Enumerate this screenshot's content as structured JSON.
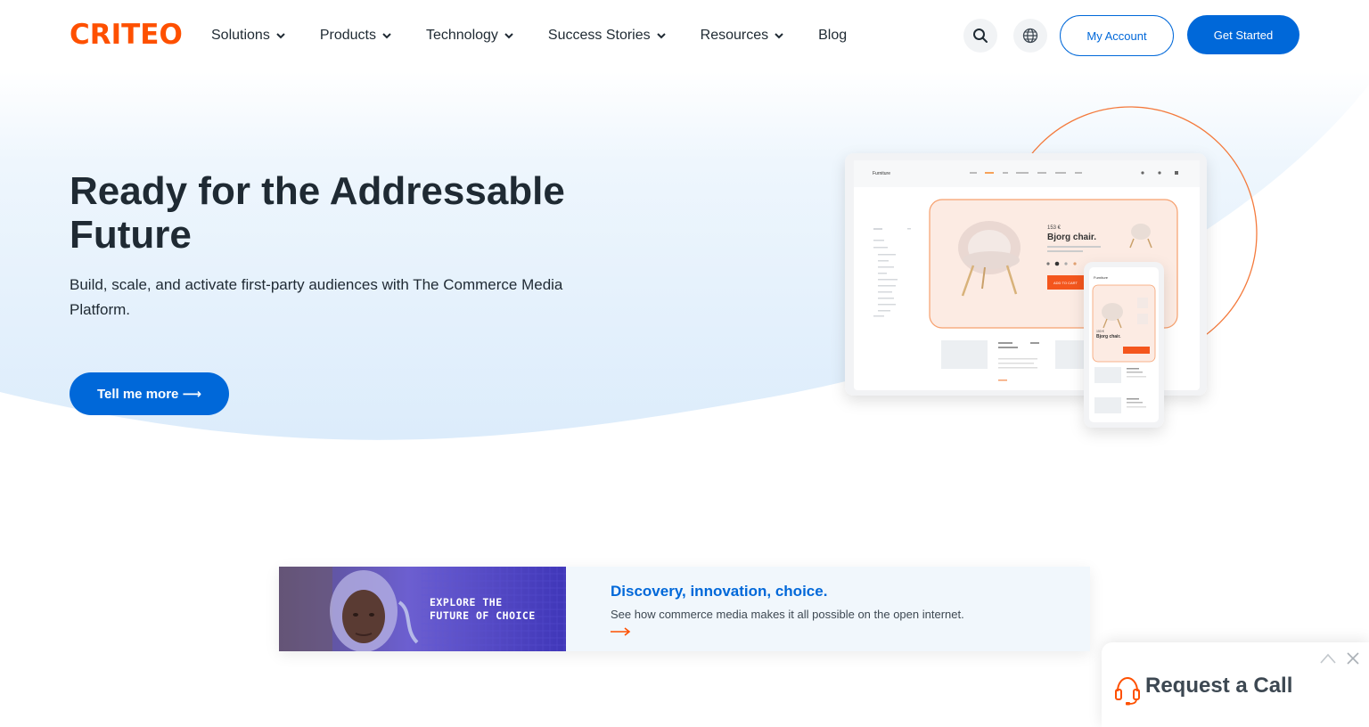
{
  "brand": {
    "logo_text": "CRITEO",
    "accent": "#fe5000",
    "primary": "#0068d9"
  },
  "nav": {
    "items": [
      {
        "label": "Solutions"
      },
      {
        "label": "Products"
      },
      {
        "label": "Technology"
      },
      {
        "label": "Success Stories"
      },
      {
        "label": "Resources"
      }
    ],
    "blog_label": "Blog",
    "search_icon": "search-icon",
    "language_icon": "globe-icon",
    "account_label": "My Account",
    "started_label": "Get Started"
  },
  "hero": {
    "title": "Ready for the Addressable Future",
    "subtitle": "Build, scale, and activate first-party audiences with The Commerce Media Platform.",
    "cta_label": "Tell me more ⟶"
  },
  "mockup": {
    "tablet_title": "Furniture",
    "price": "153 €",
    "product_name": "Bjorg chair.",
    "add_to_cart": "ADD TO CART",
    "phone_title": "Furniture",
    "phone_price": "153 €",
    "phone_product": "Bjorg chair."
  },
  "promo": {
    "overlay_line1": "EXPLORE THE",
    "overlay_line2": "FUTURE OF CHOICE",
    "title": "Discovery, innovation, choice.",
    "description": "See how commerce media makes it all possible on the open internet."
  },
  "call_widget": {
    "label": "Request a Call",
    "icon": "headset-icon"
  }
}
